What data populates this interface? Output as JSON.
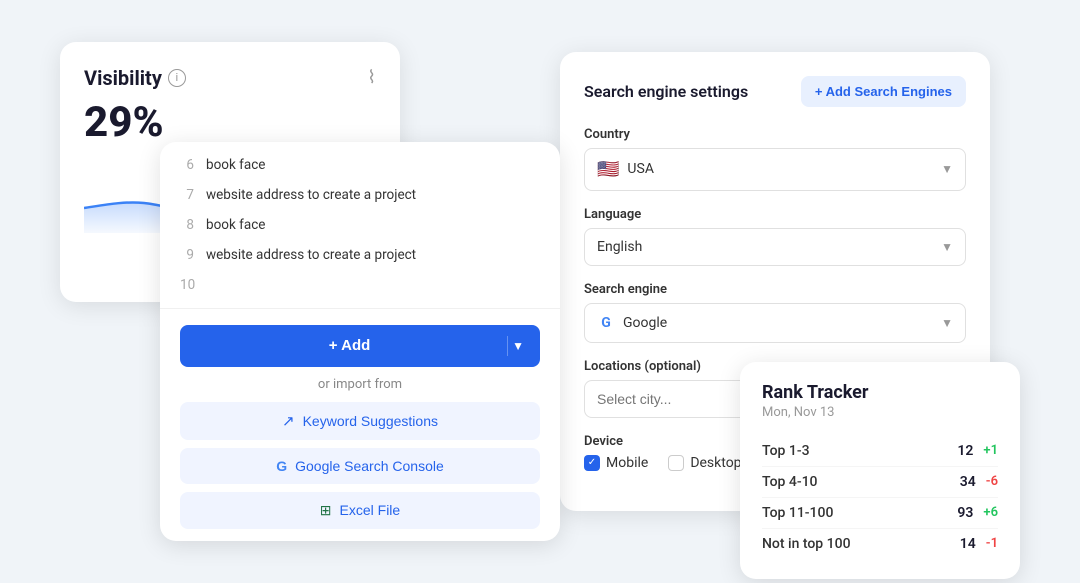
{
  "visibility": {
    "title": "Visibility",
    "percent": "29%",
    "tooltip": "i",
    "trend_icon": "〰"
  },
  "keywords": {
    "items": [
      {
        "num": "6",
        "text": "book face"
      },
      {
        "num": "7",
        "text": "website address to create a project"
      },
      {
        "num": "8",
        "text": "book face"
      },
      {
        "num": "9",
        "text": "website address to create a project"
      },
      {
        "num": "10",
        "text": ""
      }
    ],
    "add_label": "+ Add",
    "import_label": "or import from",
    "keyword_suggestions": "Keyword Suggestions",
    "google_search_console": "Google Search Console",
    "excel_file": "Excel File"
  },
  "settings": {
    "title": "Search engine settings",
    "add_engines_label": "+ Add Search Engines",
    "country_label": "Country",
    "country_value": "USA",
    "language_label": "Language",
    "language_value": "English",
    "search_engine_label": "Search engine",
    "search_engine_value": "Google",
    "locations_label": "Locations (optional)",
    "locations_placeholder": "Select city...",
    "device_label": "Device",
    "device_mobile": "Mobile",
    "device_desktop": "Desktop"
  },
  "rank_tracker": {
    "title": "Rank Tracker",
    "date": "Mon, Nov 13",
    "rows": [
      {
        "label": "Top 1-3",
        "count": "12",
        "delta": "+1",
        "delta_type": "green"
      },
      {
        "label": "Top 4-10",
        "count": "34",
        "delta": "-6",
        "delta_type": "red"
      },
      {
        "label": "Top 11-100",
        "count": "93",
        "delta": "+6",
        "delta_type": "green"
      },
      {
        "label": "Not in top 100",
        "count": "14",
        "delta": "-1",
        "delta_type": "red"
      }
    ]
  }
}
